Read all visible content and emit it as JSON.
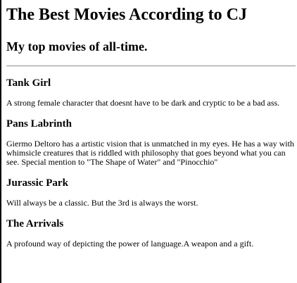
{
  "page": {
    "title": "The Best Movies According to CJ",
    "subtitle": "My top movies of all-time."
  },
  "movies": [
    {
      "title": "Tank Girl",
      "description": "A strong female character that doesnt have to be dark and cryptic to be a bad ass."
    },
    {
      "title": "Pans Labrinth",
      "description": "Giermo Deltoro has a artistic vision that is unmatched in my eyes. He has a way with whimsicle creatures that is riddled with philosophy that goes beyond what you can see. Special mention to \"The Shape of Water\" and \"Pinocchio\""
    },
    {
      "title": "Jurassic Park",
      "description": "Will always be a classic. But the 3rd is always the worst."
    },
    {
      "title": "The Arrivals",
      "description": "A profound way of depicting the power of language.A weapon and a gift."
    }
  ]
}
